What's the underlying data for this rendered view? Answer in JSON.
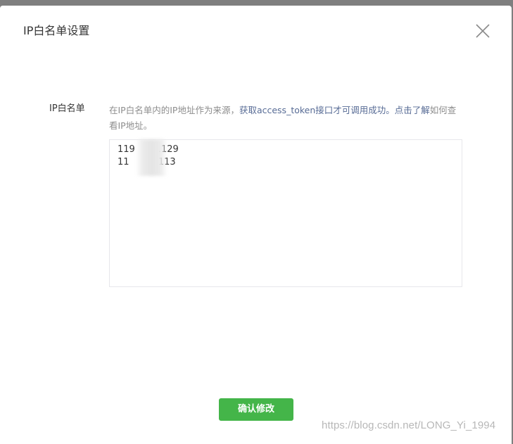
{
  "dialog": {
    "title": "IP白名单设置",
    "close_icon": "close-icon"
  },
  "form": {
    "label": "IP白名单",
    "description": {
      "text_before": "在IP白名单内的IP地址作为来源，",
      "link_api": "获取access_token接口才可调用成功。",
      "link_learn": "点击了解",
      "text_after": "如何查看IP地址。"
    },
    "ip_list_value": "119        .129\n11          113"
  },
  "footer": {
    "confirm_label": "确认修改"
  },
  "watermark": "https://blog.csdn.net/LONG_Yi_1994",
  "colors": {
    "primary_green": "#44b549",
    "link_blue": "#576b95",
    "overlay_gray": "#7f7f7f"
  }
}
